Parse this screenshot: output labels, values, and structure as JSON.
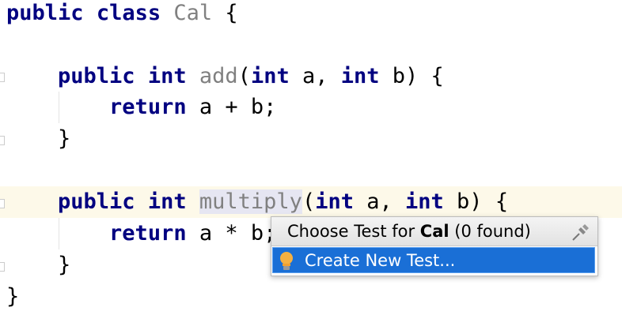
{
  "code": {
    "l1": {
      "k1": "public",
      "k2": "class",
      "name": "Cal",
      "rest": " {"
    },
    "l3": {
      "indent": "    ",
      "k1": "public",
      "k2": "int",
      "name": "add",
      "p1": "(",
      "k3": "int",
      "a": " a, ",
      "k4": "int",
      "b": " b) {"
    },
    "l4": {
      "indent": "        ",
      "k1": "return",
      "rest": " a + b;"
    },
    "l5": {
      "text": "    }"
    },
    "l7": {
      "indent": "    ",
      "k1": "public",
      "k2": "int",
      "name": "multiply",
      "p1": "(",
      "k3": "int",
      "a": " a, ",
      "k4": "int",
      "b": " b) {"
    },
    "l8": {
      "indent": "        ",
      "k1": "return",
      "rest": " a * b;"
    },
    "l9": {
      "text": "    }"
    },
    "l10": {
      "text": "}"
    }
  },
  "popup": {
    "title_prefix": "Choose Test for ",
    "title_class": "Cal",
    "title_suffix": " (0 found)",
    "item": "Create New Test..."
  },
  "colors": {
    "keyword": "#000080",
    "name": "#808080",
    "selection": "#1a6fd6",
    "current_line": "#fdf9e9"
  }
}
